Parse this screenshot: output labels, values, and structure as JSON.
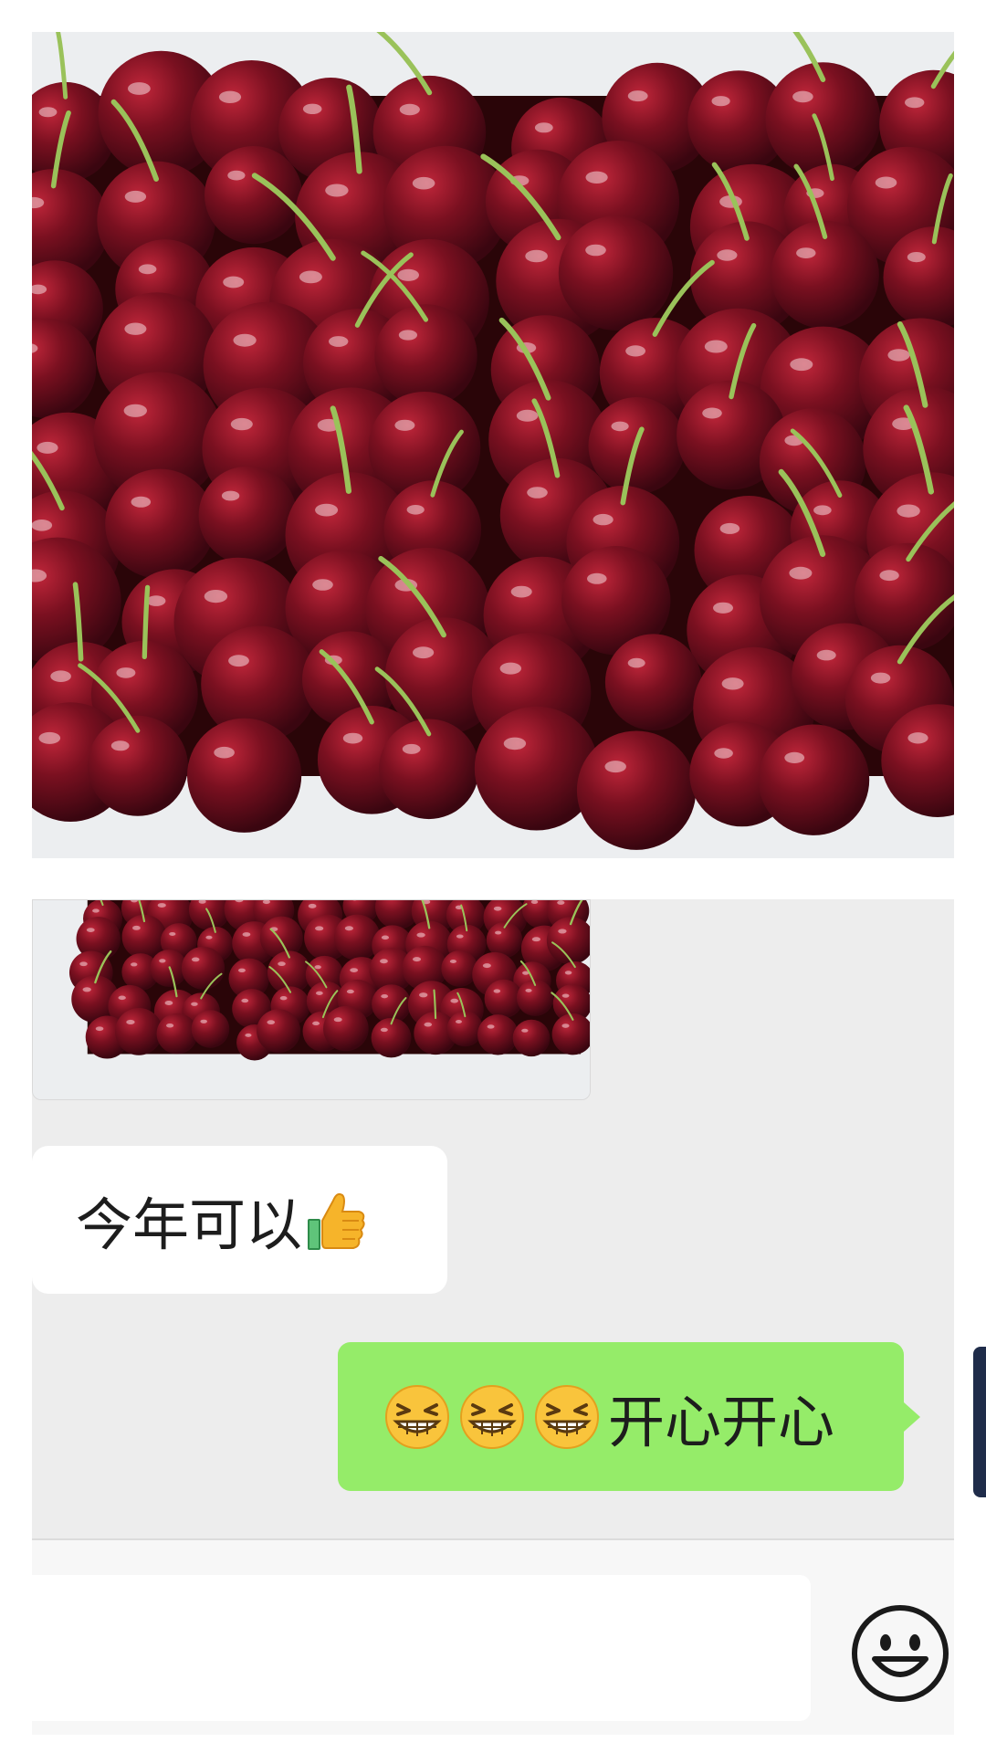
{
  "chat": {
    "incoming_message": "今年可以",
    "outgoing_message": "开心开心"
  },
  "icons": {
    "incoming_emoji": "thumbs-up-icon",
    "outgoing_emoji": "grinning-squinting-face-icon",
    "input_bar_button": "smiley-face-icon"
  },
  "colors": {
    "outgoing_bubble": "#95ec69",
    "incoming_bubble": "#ffffff",
    "chat_background": "#ededed"
  },
  "input": {
    "value": "",
    "placeholder": ""
  }
}
